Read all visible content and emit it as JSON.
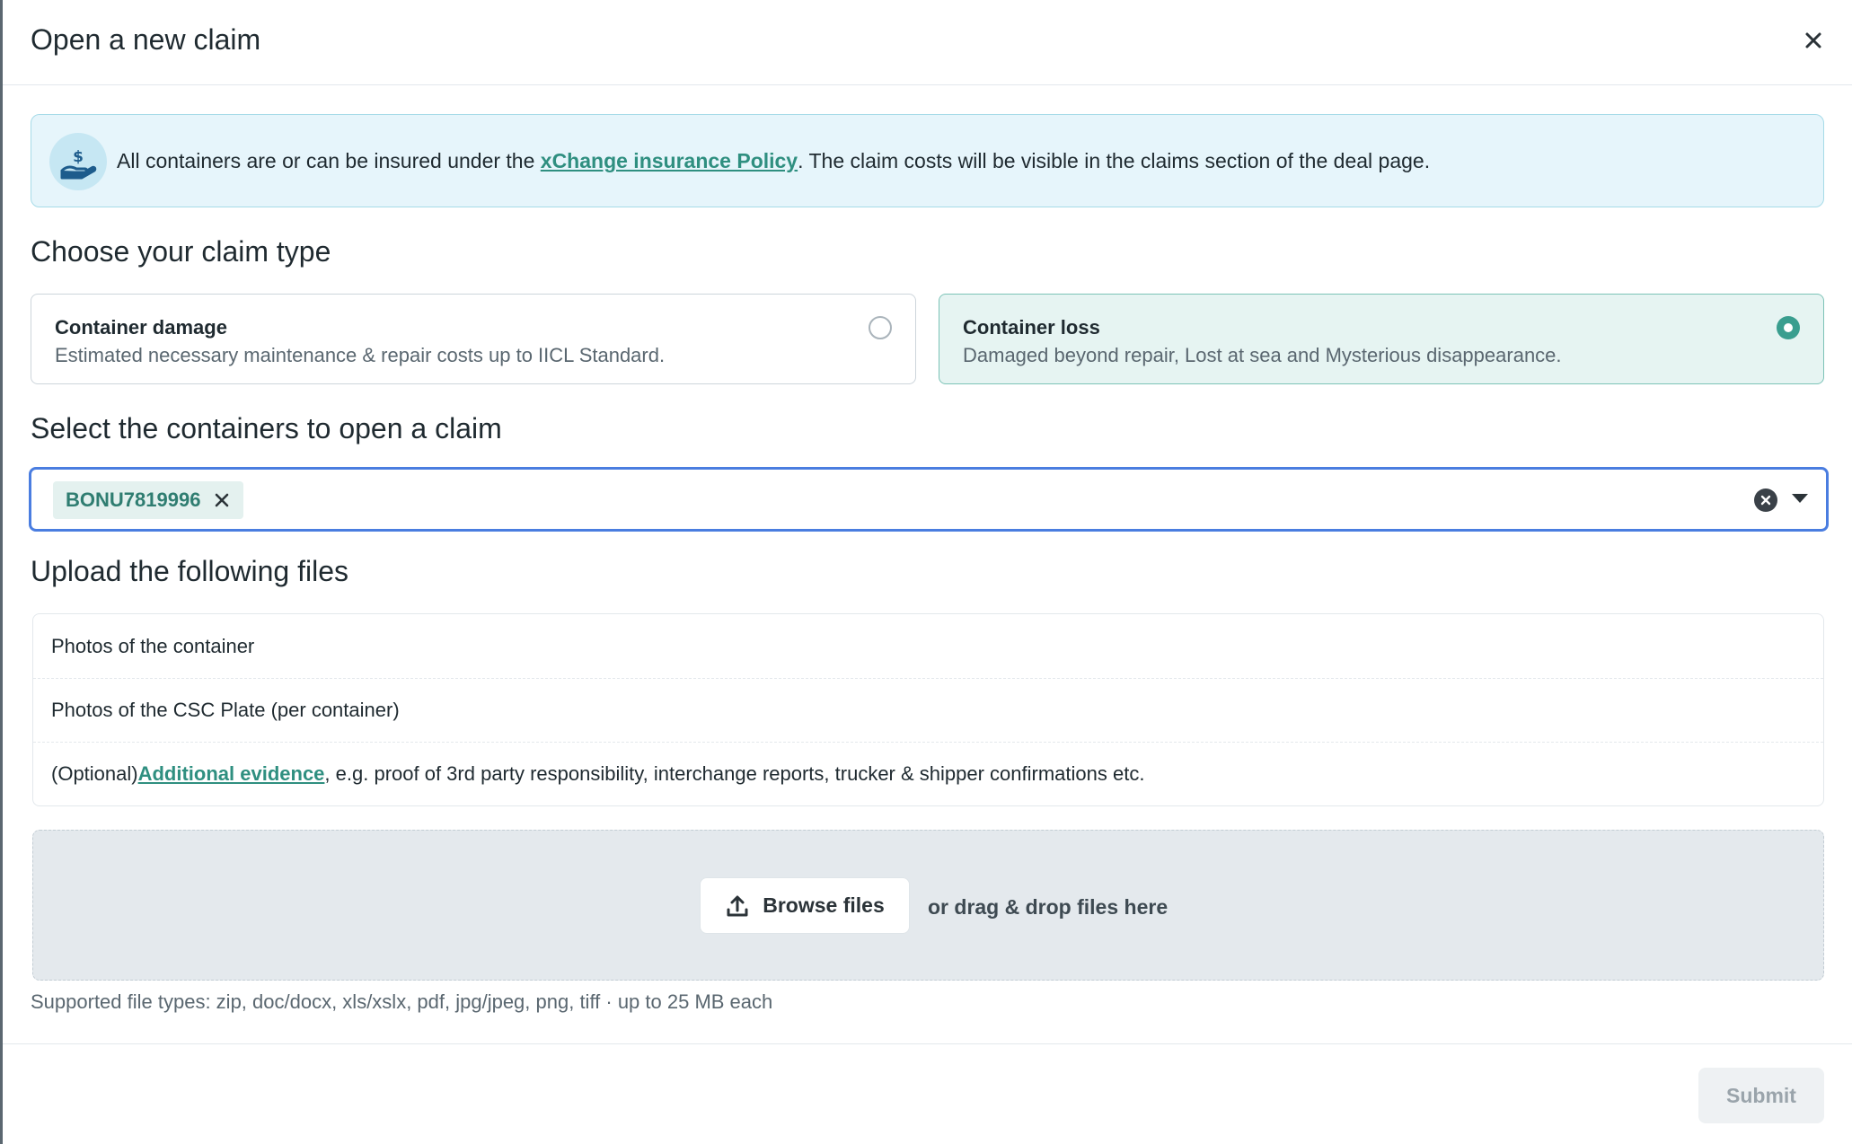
{
  "modal": {
    "title": "Open a new claim",
    "close_icon": "close-icon"
  },
  "info_banner": {
    "icon": "insurance-hand-dollar-icon",
    "text_before": "All containers are or can be insured under the ",
    "link_text": "xChange insurance Policy",
    "text_after": ". The claim costs will be visible in the claims section of the deal page."
  },
  "claim_type": {
    "heading": "Choose your claim type",
    "options": [
      {
        "title": "Container damage",
        "description": "Estimated necessary maintenance & repair costs up to IICL Standard.",
        "selected": false
      },
      {
        "title": "Container loss",
        "description": "Damaged beyond repair, Lost at sea and Mysterious disappearance.",
        "selected": true
      }
    ]
  },
  "containers": {
    "heading": "Select the containers to open a claim",
    "selected": [
      "BONU7819996"
    ]
  },
  "upload": {
    "heading": "Upload the following files",
    "required_files": [
      "Photos of the container",
      "Photos of the CSC Plate (per container)"
    ],
    "optional_prefix": "(Optional) ",
    "optional_link": "Additional evidence",
    "optional_suffix": ", e.g. proof of 3rd party responsibility, interchange reports, trucker & shipper confirmations etc.",
    "browse_label": "Browse files",
    "drag_text": "or drag & drop files here",
    "supported_text": "Supported file types: zip, doc/docx, xls/xslx, pdf, jpg/jpeg, png, tiff · up to 25 MB each"
  },
  "footer": {
    "submit_label": "Submit"
  },
  "colors": {
    "accent": "#3a9e8f",
    "link": "#2f8f80",
    "focus": "#4a7de0",
    "info_bg": "#e6f5fb"
  }
}
